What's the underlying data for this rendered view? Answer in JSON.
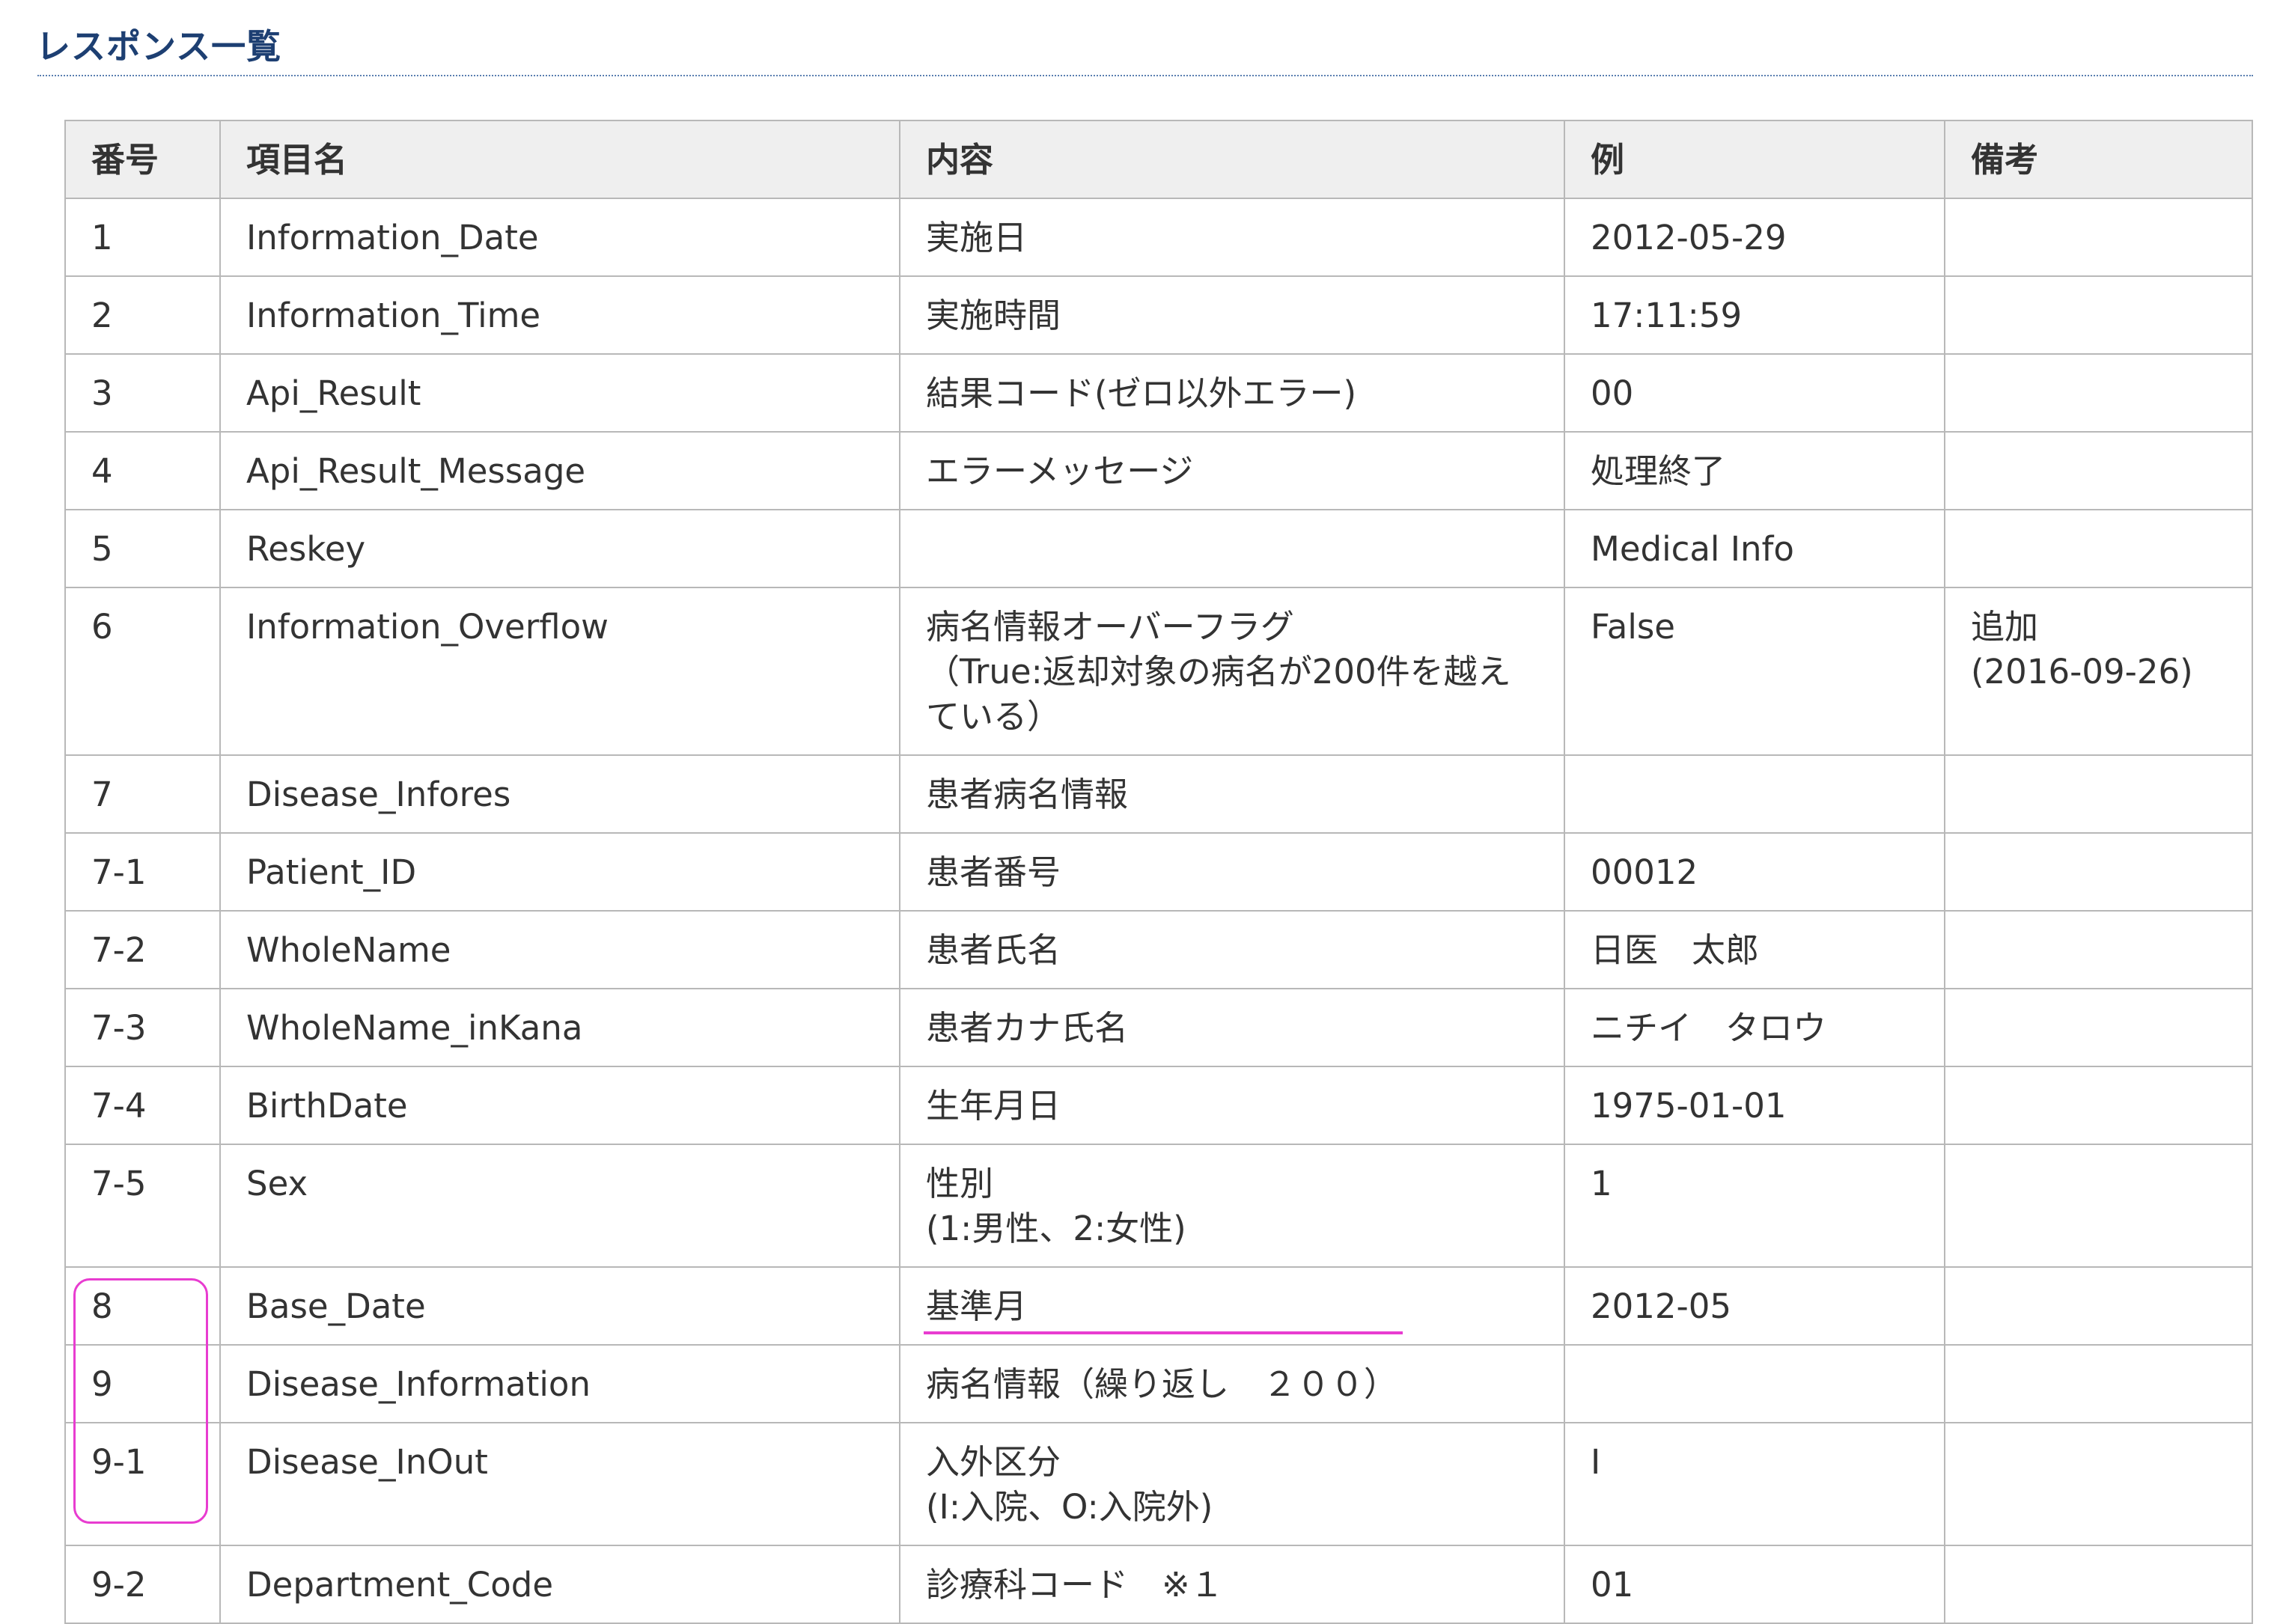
{
  "page": {
    "title": "レスポンス一覧"
  },
  "table": {
    "headers": [
      "番号",
      "項目名",
      "内容",
      "例",
      "備考"
    ],
    "rows": [
      {
        "no": "1",
        "name": "Information_Date",
        "desc": "実施日",
        "example": "2012-05-29",
        "note": ""
      },
      {
        "no": "2",
        "name": "Information_Time",
        "desc": "実施時間",
        "example": "17:11:59",
        "note": ""
      },
      {
        "no": "3",
        "name": "Api_Result",
        "desc": "結果コード(ゼロ以外エラー)",
        "example": "00",
        "note": ""
      },
      {
        "no": "4",
        "name": "Api_Result_Message",
        "desc": "エラーメッセージ",
        "example": "処理終了",
        "note": ""
      },
      {
        "no": "5",
        "name": "Reskey",
        "desc": "",
        "example": "Medical Info",
        "note": ""
      },
      {
        "no": "6",
        "name": "Information_Overflow",
        "desc": "病名情報オーバーフラグ\n（True:返却対象の病名が200件を越え\nている）",
        "example": "False",
        "note": "追加\n(2016-09-26)"
      },
      {
        "no": "7",
        "name": "Disease_Infores",
        "desc": "患者病名情報",
        "example": "",
        "note": ""
      },
      {
        "no": "7-1",
        "name": "Patient_ID",
        "desc": "患者番号",
        "example": "00012",
        "note": ""
      },
      {
        "no": "7-2",
        "name": "WholeName",
        "desc": "患者氏名",
        "example": "日医　太郎",
        "note": ""
      },
      {
        "no": "7-3",
        "name": "WholeName_inKana",
        "desc": "患者カナ氏名",
        "example": "ニチイ　タロウ",
        "note": ""
      },
      {
        "no": "7-4",
        "name": "BirthDate",
        "desc": "生年月日",
        "example": "1975-01-01",
        "note": ""
      },
      {
        "no": "7-5",
        "name": "Sex",
        "desc": "性別\n(1:男性、2:女性)",
        "example": "1",
        "note": ""
      },
      {
        "no": "8",
        "name": "Base_Date",
        "desc": "基準月",
        "example": "2012-05",
        "note": ""
      },
      {
        "no": "9",
        "name": "Disease_Information",
        "desc": "病名情報（繰り返し　２００）",
        "example": "",
        "note": ""
      },
      {
        "no": "9-1",
        "name": "Disease_InOut",
        "desc": "入外区分\n(I:入院、O:入院外)",
        "example": "I",
        "note": ""
      },
      {
        "no": "9-2",
        "name": "Department_Code",
        "desc": "診療科コード　※１",
        "example": "01",
        "note": ""
      }
    ]
  },
  "annotations": {
    "highlight_color": "#e83cd0"
  }
}
